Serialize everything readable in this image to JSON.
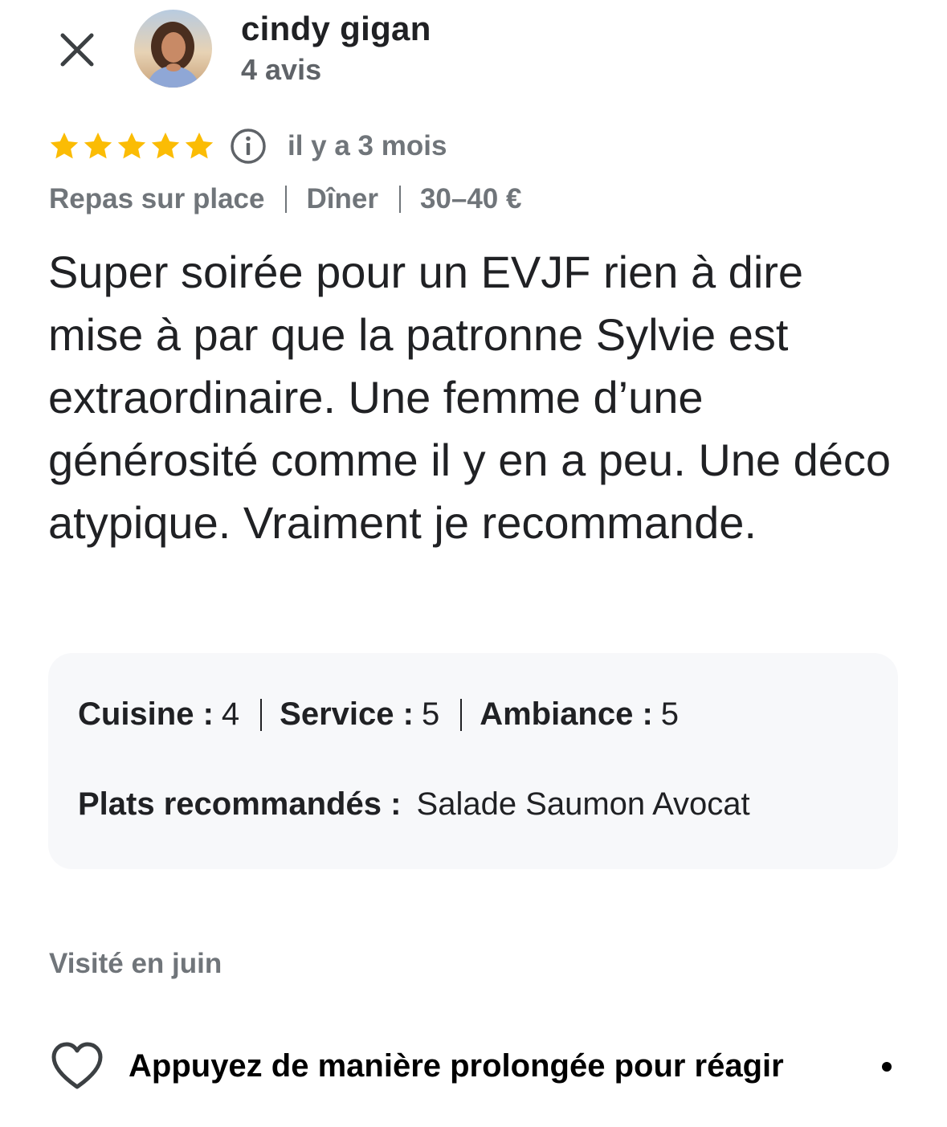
{
  "header": {
    "close_icon": "close-icon",
    "author_name": "cindy gigan",
    "review_count": "4 avis"
  },
  "rating": {
    "stars": 5,
    "max_stars": 5,
    "star_color": "#fbbc04",
    "info_icon": "info-icon",
    "time_ago": "il y a 3 mois"
  },
  "meta": {
    "service_type": "Repas sur place",
    "meal_type": "Dîner",
    "price_range": "30–40 €"
  },
  "review": {
    "text": "Super soirée pour un EVJF rien à dire mise à par que la patronne Sylvie est extraordinaire. Une femme d’une générosité comme il y en a peu. Une déco atypique. Vraiment je recommande."
  },
  "details": {
    "cuisine_label": "Cuisine :",
    "cuisine_value": "4",
    "service_label": "Service :",
    "service_value": "5",
    "ambiance_label": "Ambiance :",
    "ambiance_value": "5",
    "dishes_label": "Plats recommandés :",
    "dishes_value": "Salade Saumon Avocat"
  },
  "visited": "Visité en juin",
  "react": {
    "heart_icon": "heart-icon",
    "label": "Appuyez de manière prolongée pour réagir"
  }
}
